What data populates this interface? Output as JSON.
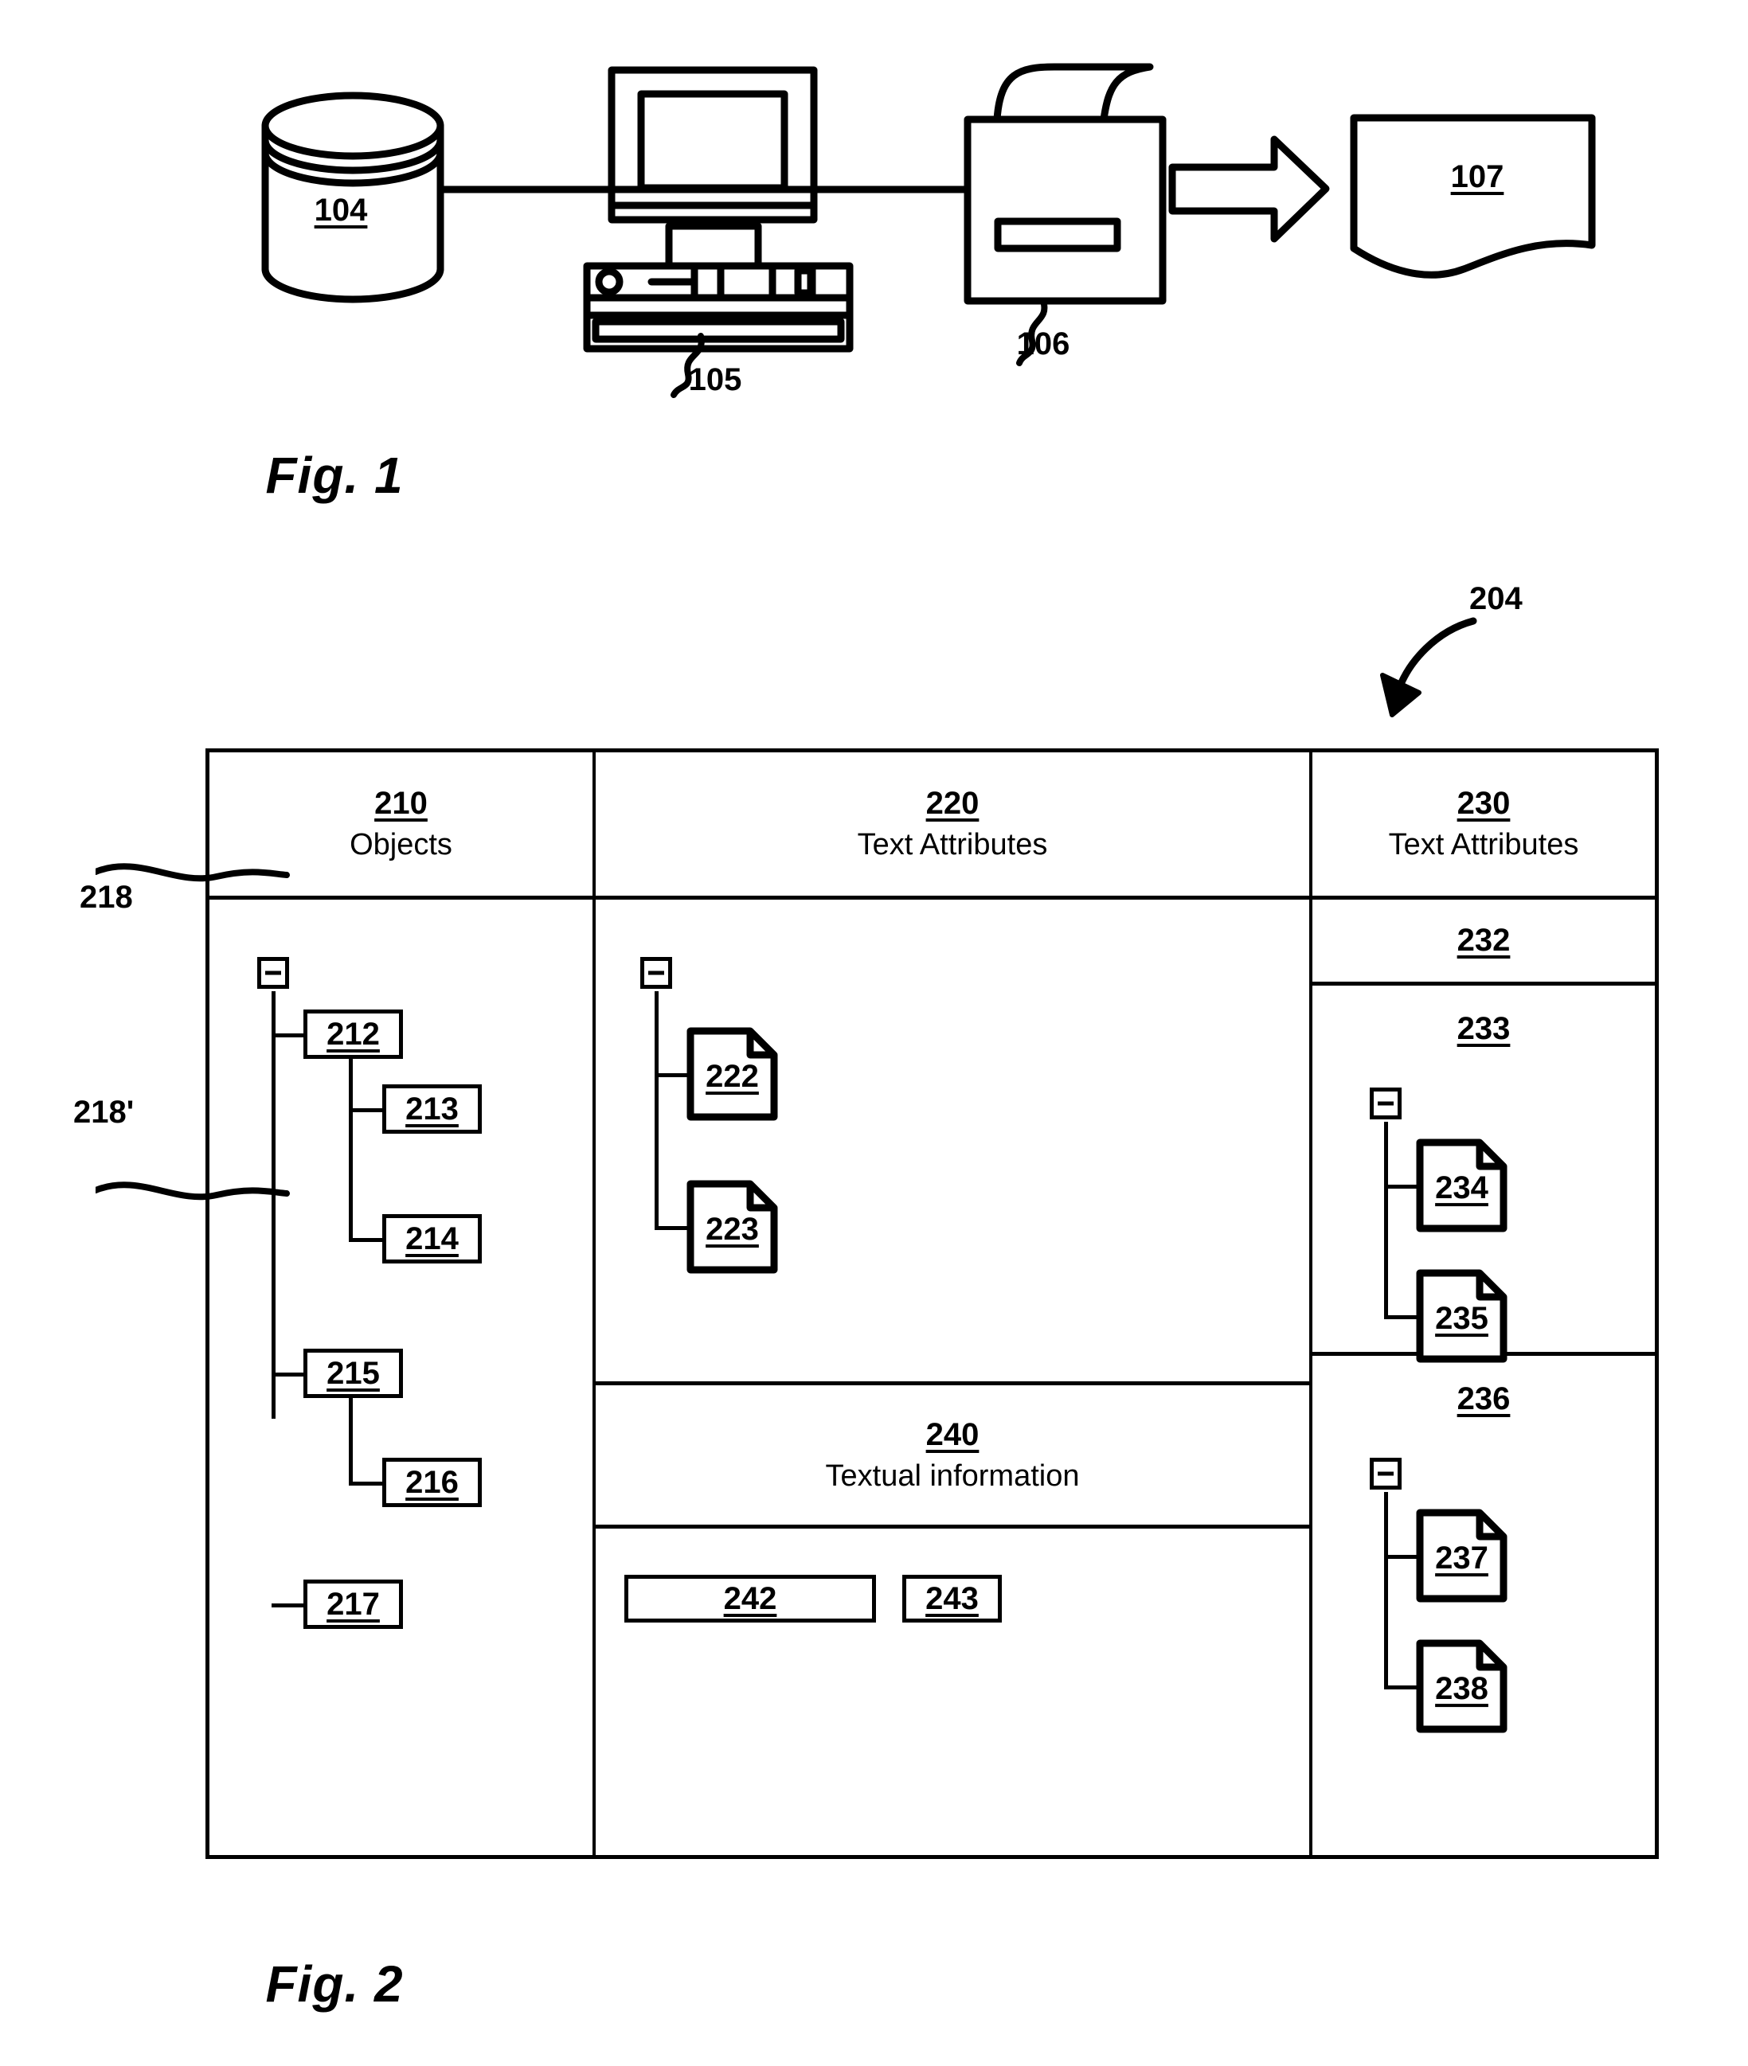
{
  "figures": [
    {
      "id": "fig1",
      "caption": "Fig. 1",
      "components": [
        {
          "ref": "104",
          "name": "database-cylinder"
        },
        {
          "ref": "105",
          "name": "computer-workstation"
        },
        {
          "ref": "106",
          "name": "printer"
        },
        {
          "ref": "107",
          "name": "printed-document"
        }
      ],
      "arrow": "right-arrow"
    },
    {
      "id": "fig2",
      "caption": "Fig. 2",
      "callout": "204",
      "table": {
        "columns": [
          {
            "number": "210",
            "title": "Objects"
          },
          {
            "number": "220",
            "title": "Text Attributes"
          },
          {
            "number": "230",
            "title": "Text Attributes"
          }
        ],
        "objects_column": {
          "expander": "minus-box",
          "nodes": [
            "212",
            "213",
            "214",
            "215",
            "216",
            "217"
          ],
          "bracket_labels": [
            "218",
            "218'"
          ]
        },
        "text_attributes_column": {
          "expander": "minus-box",
          "documents": [
            "222",
            "223"
          ],
          "sections": [
            {
              "number": "240",
              "title": "Textual information"
            },
            {
              "fields": [
                "242",
                "243"
              ]
            }
          ]
        },
        "right_column": {
          "sections": [
            {
              "number": "232",
              "documents": []
            },
            {
              "number": "233",
              "expander": "minus-box",
              "documents": [
                "234",
                "235"
              ]
            },
            {
              "number": "236",
              "expander": "minus-box",
              "documents": [
                "237",
                "238"
              ]
            }
          ]
        }
      }
    }
  ],
  "colors": {
    "ink": "#000000",
    "paper": "#ffffff"
  }
}
